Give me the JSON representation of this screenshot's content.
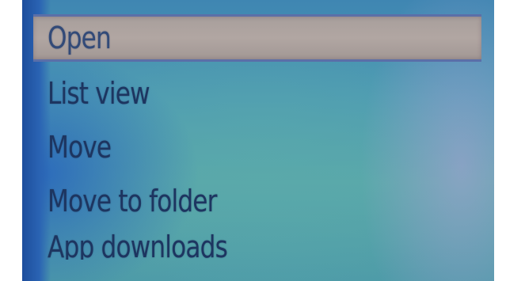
{
  "menu": {
    "items": [
      {
        "label": "Open",
        "selected": true
      },
      {
        "label": "List view",
        "selected": false
      },
      {
        "label": "Move",
        "selected": false
      },
      {
        "label": "Move to folder",
        "selected": false
      },
      {
        "label": "App downloads",
        "selected": false
      }
    ]
  },
  "colors": {
    "screen_background": "#5aa8aa",
    "selection_highlight": "#aca29f",
    "selection_border": "#5b6fa8",
    "menu_text": "#1d3560"
  }
}
